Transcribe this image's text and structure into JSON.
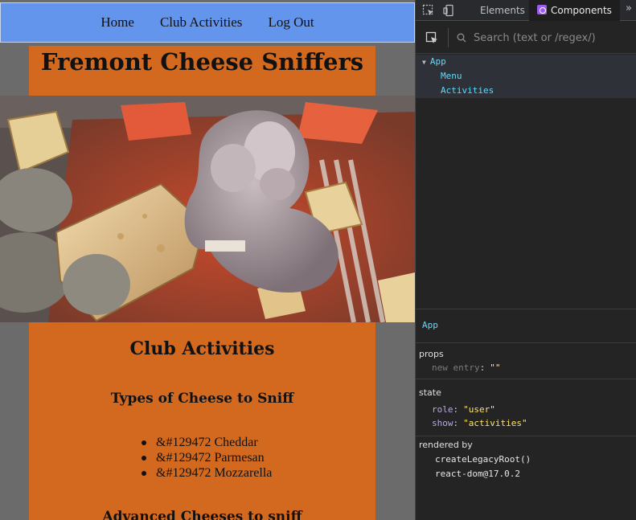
{
  "nav": {
    "links": [
      "Home",
      "Club Activities",
      "Log Out"
    ]
  },
  "site": {
    "title": "Fremont Cheese Sniffers"
  },
  "hero_image": {
    "description": "Claymation figure sniffing cheese and crackers",
    "accent_color": "#e35a35"
  },
  "activities": {
    "section_title": "Club Activities",
    "cheese_heading": "Types of Cheese to Sniff",
    "cheese_list": [
      "&#129472 Cheddar",
      "&#129472 Parmesan",
      "&#129472 Mozzarella"
    ],
    "advanced_heading": "Advanced Cheeses to sniff"
  },
  "devtools": {
    "tabs": [
      "Elements",
      "Components"
    ],
    "active_tab": "Components",
    "more_icon": "double-chevron-icon",
    "search_placeholder": "Search (text or /regex/)",
    "tree": {
      "root": "App",
      "children": [
        "Menu",
        "Activities"
      ]
    },
    "inspector": {
      "selected": "App",
      "props_title": "props",
      "props": [
        {
          "key": "new entry",
          "value": "\"\""
        }
      ],
      "state_title": "state",
      "state": [
        {
          "key": "role",
          "value": "\"user\""
        },
        {
          "key": "show",
          "value": "\"activities\""
        }
      ],
      "rendered_by_title": "rendered by",
      "rendered_by": [
        "createLegacyRoot()",
        "react-dom@17.0.2"
      ]
    }
  },
  "colors": {
    "nav_bg": "#6495ed",
    "orange": "#d2691e",
    "page_bg": "#6b6b6b",
    "devtools_bg": "#242424",
    "component_name": "#61dafb",
    "value_yellow": "#ffe46b"
  }
}
